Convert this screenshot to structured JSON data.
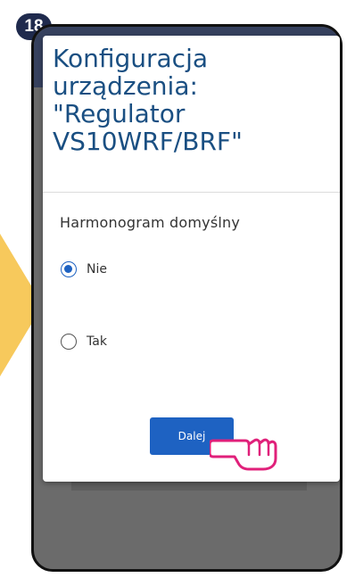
{
  "step": {
    "number": "18"
  },
  "dialog": {
    "title": "Konfiguracja\nurządzenia:\n\"Regulator\nVS10WRF/BRF\"",
    "section_label": "Harmonogram domyślny",
    "options": [
      {
        "label": "Nie",
        "selected": true
      },
      {
        "label": "Tak",
        "selected": false
      }
    ],
    "next_button_label": "Dalej"
  },
  "colors": {
    "badge": "#1f2a4d",
    "title": "#1a4f82",
    "accent": "#1e62c2",
    "arrow": "#f7c95c",
    "pointer_hand": "#e0207a"
  },
  "icons": {
    "arrow": "arrow-right-icon",
    "pointer": "pointing-hand-icon"
  }
}
